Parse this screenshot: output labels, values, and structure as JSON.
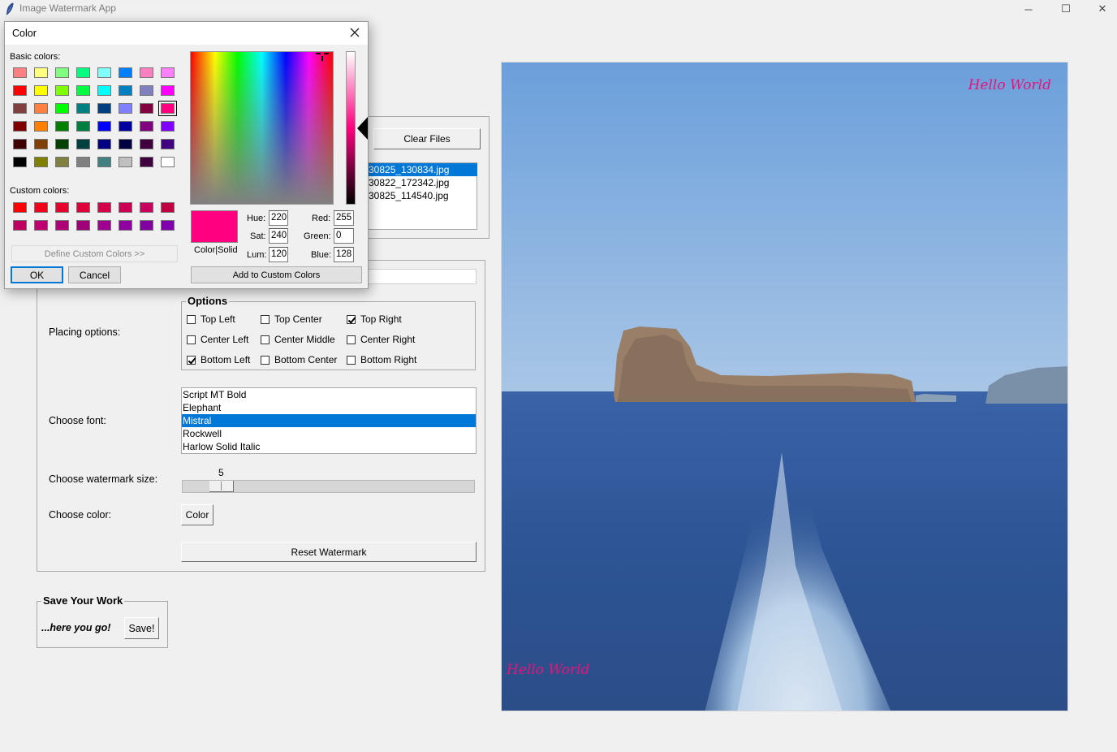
{
  "window": {
    "title": "Image Watermark App",
    "minimize": "─",
    "maximize": "☐",
    "close": "✕"
  },
  "file_panel": {
    "clear_button": "Clear Files",
    "files": [
      "30825_130834.jpg",
      "30822_172342.jpg",
      "30825_114540.jpg"
    ],
    "selected_index": 0
  },
  "watermark_panel": {
    "placing_label": "Placing options:",
    "options_title": "Options",
    "options": [
      {
        "label": "Top Left",
        "checked": false
      },
      {
        "label": "Top Center",
        "checked": false
      },
      {
        "label": "Top Right",
        "checked": true
      },
      {
        "label": "Center Left",
        "checked": false
      },
      {
        "label": "Center Middle",
        "checked": false
      },
      {
        "label": "Center Right",
        "checked": false
      },
      {
        "label": "Bottom Left",
        "checked": true
      },
      {
        "label": "Bottom Center",
        "checked": false
      },
      {
        "label": "Bottom Right",
        "checked": false
      }
    ],
    "font_label": "Choose font:",
    "fonts": [
      "Script MT Bold",
      "Elephant",
      "Mistral",
      "Rockwell",
      "Harlow Solid Italic"
    ],
    "selected_font_index": 2,
    "size_label": "Choose watermark size:",
    "size_value": "5",
    "size_fraction": 0.1,
    "color_label": "Choose color:",
    "color_button": "Color",
    "reset_button": "Reset Watermark"
  },
  "save_panel": {
    "title": "Save Your Work",
    "prompt": "...here you go!",
    "save_button": "Save!"
  },
  "preview": {
    "watermark_top": "Hello World",
    "watermark_bottom": "Hello World",
    "watermark_color": "#e8137a"
  },
  "color_dialog": {
    "title": "Color",
    "basic_label": "Basic colors:",
    "custom_label": "Custom colors:",
    "define_button": "Define Custom Colors >>",
    "ok_button": "OK",
    "cancel_button": "Cancel",
    "add_button": "Add to Custom Colors",
    "color_solid_label": "Color|Solid",
    "hue_label": "Hue:",
    "hue": "220",
    "sat_label": "Sat:",
    "sat": "240",
    "lum_label": "Lum:",
    "lum": "120",
    "red_label": "Red:",
    "red": "255",
    "green_label": "Green:",
    "green": "0",
    "blue_label": "Blue:",
    "blue": "128",
    "current_color": "#ff0080",
    "basic_colors": [
      "#ff8080",
      "#ffff80",
      "#80ff80",
      "#00ff80",
      "#80ffff",
      "#0080ff",
      "#ff80c0",
      "#ff80ff",
      "#ff0000",
      "#ffff00",
      "#80ff00",
      "#00ff40",
      "#00ffff",
      "#0080c0",
      "#8080c0",
      "#ff00ff",
      "#804040",
      "#ff8040",
      "#00ff00",
      "#008080",
      "#004080",
      "#8080ff",
      "#800040",
      "#ff0080",
      "#800000",
      "#ff8000",
      "#008000",
      "#008040",
      "#0000ff",
      "#0000a0",
      "#800080",
      "#8000ff",
      "#400000",
      "#804000",
      "#004000",
      "#004040",
      "#000080",
      "#000040",
      "#400040",
      "#400080",
      "#000000",
      "#808000",
      "#808040",
      "#808080",
      "#408080",
      "#c0c0c0",
      "#400040",
      "#ffffff"
    ],
    "selected_basic_index": 23,
    "custom_colors": [
      "#ff0000",
      "#f0001a",
      "#e6002e",
      "#e0003a",
      "#d4004a",
      "#cc0052",
      "#c8005e",
      "#c00040",
      "#c00060",
      "#c00070",
      "#b00078",
      "#a00078",
      "#a00090",
      "#9000a0",
      "#8000a0",
      "#8000b0"
    ]
  }
}
